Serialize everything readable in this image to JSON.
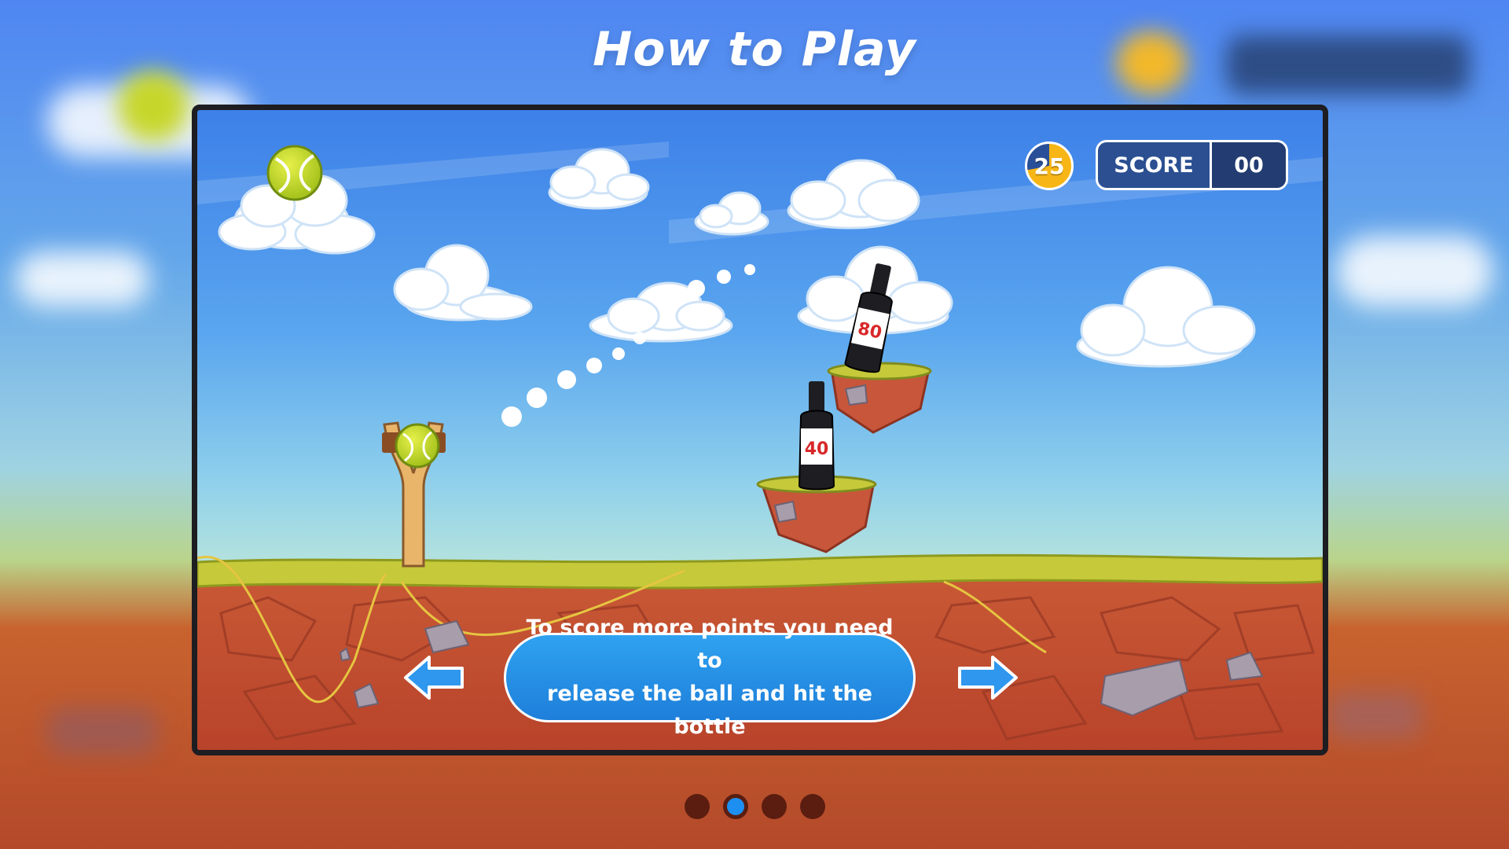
{
  "title": "How to Play",
  "hud": {
    "coins": "25",
    "score_label": "SCORE",
    "score_value": "00"
  },
  "bottles": [
    {
      "label": "40"
    },
    {
      "label": "80"
    }
  ],
  "instruction": "To score more points you need to\nrelease the ball and hit the bottle",
  "navigation": {
    "prev_icon": "arrow-left-icon",
    "next_icon": "arrow-right-icon",
    "page_count": 4,
    "active_page": 2
  },
  "colors": {
    "accent": "#1d8ff0",
    "score_panel": "#2b4f91",
    "coin": "#f7b615",
    "bottle_label_text": "#d8282a"
  }
}
